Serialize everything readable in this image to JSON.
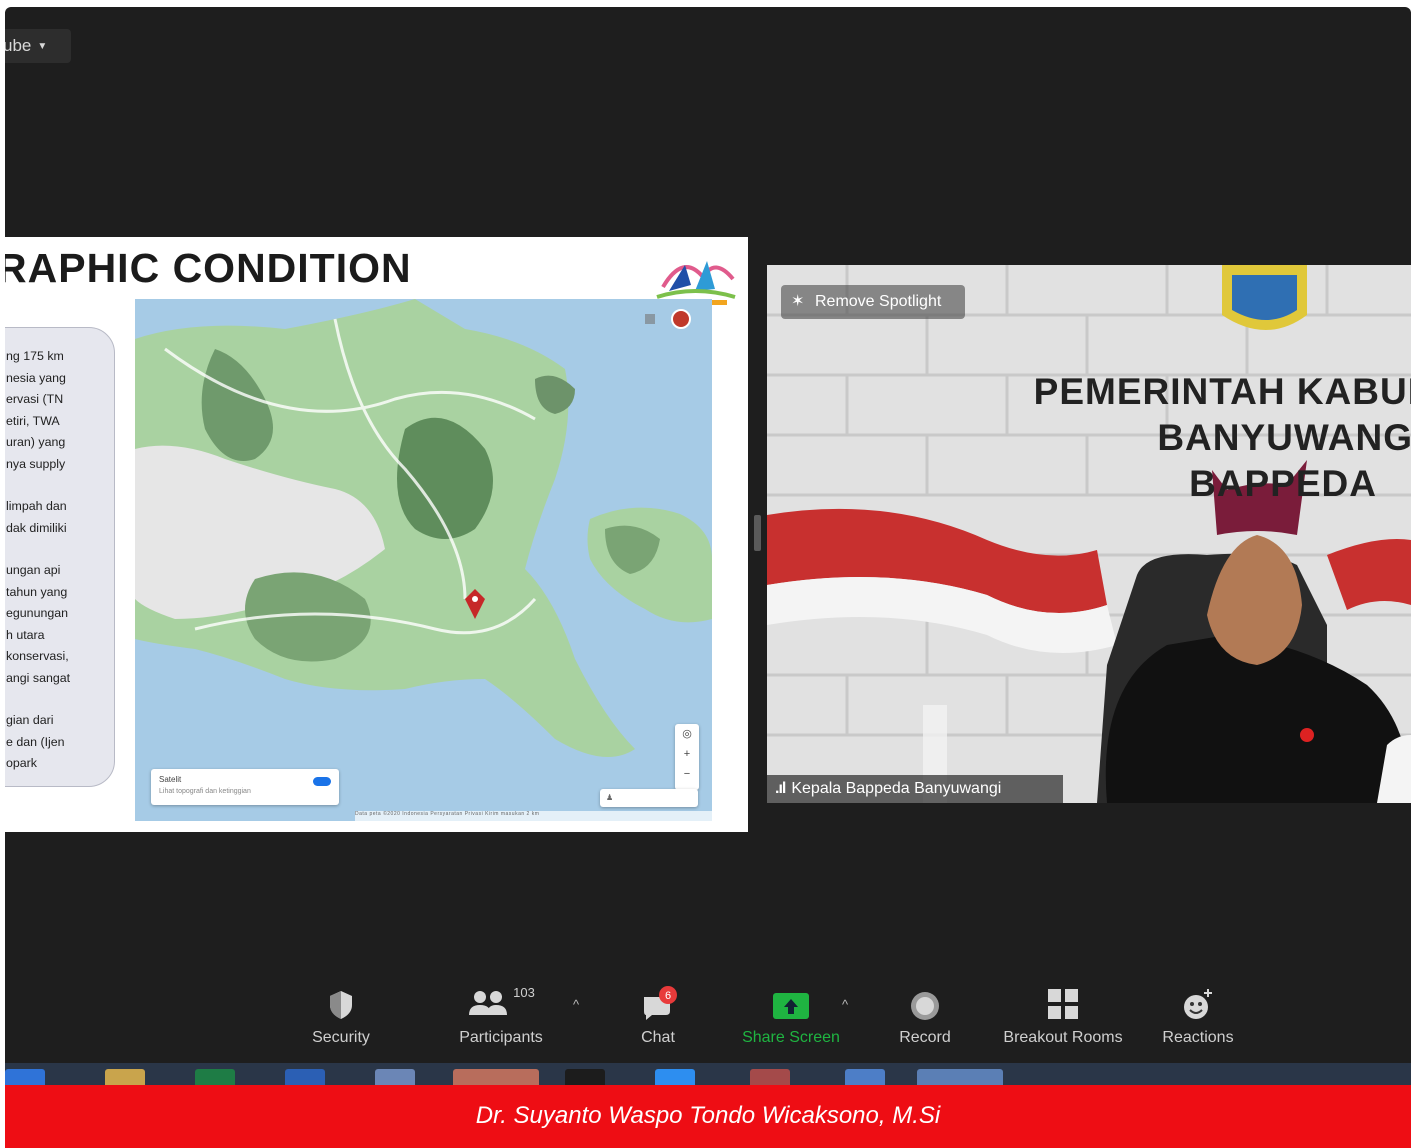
{
  "browser": {
    "tab_label": "ube",
    "tab_menu_icon": "caret-down-icon"
  },
  "slide": {
    "title": "RAPHIC CONDITION",
    "text_lines": [
      "ng 175 km",
      "nesia yang",
      "ervasi (TN",
      "etiri, TWA",
      "uran) yang",
      "nya supply",
      "",
      "limpah dan",
      "dak dimiliki",
      "",
      "ungan api",
      "tahun yang",
      "egunungan",
      "h utara",
      "konservasi,",
      "angi sangat",
      "",
      "gian dari",
      "e dan (Ijen",
      "opark"
    ]
  },
  "map": {
    "search_title": "Satelit",
    "search_subtitle": "Lihat topografi dan ketinggian",
    "footer": "Data peta ©2020   Indonesia   Persyaratan   Privasi   Kirim masukan   2 km"
  },
  "video": {
    "spotlight_label": "Remove Spotlight",
    "banner_line1": "PEMERINTAH KABUI",
    "banner_line2": "BANYUWANG",
    "banner_line3": "BAPPEDA",
    "participant_name": "Kepala Bappeda Banyuwangi"
  },
  "toolbar": {
    "security": "Security",
    "participants": "Participants",
    "participants_count": "103",
    "chat": "Chat",
    "chat_badge": "6",
    "share_screen": "Share Screen",
    "record": "Record",
    "breakout_rooms": "Breakout Rooms",
    "reactions": "Reactions",
    "colors": {
      "share_green": "#1fb441",
      "badge_red": "#e83a3a"
    }
  },
  "caption": "Dr. Suyanto Waspo Tondo Wicaksono, M.Si"
}
